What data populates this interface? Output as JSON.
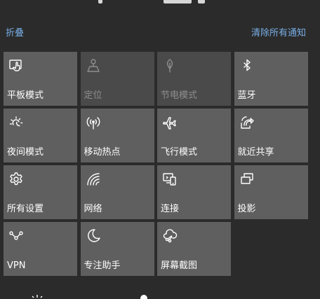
{
  "header": {
    "collapse_label": "折叠",
    "clear_all_label": "清除所有通知"
  },
  "tiles": [
    {
      "id": "tablet-mode",
      "label": "平板模式",
      "icon": "tablet-mode-icon",
      "enabled": true
    },
    {
      "id": "location",
      "label": "定位",
      "icon": "location-icon",
      "enabled": false
    },
    {
      "id": "battery-saver",
      "label": "节电模式",
      "icon": "battery-saver-icon",
      "enabled": false
    },
    {
      "id": "bluetooth",
      "label": "蓝牙",
      "icon": "bluetooth-icon",
      "enabled": true
    },
    {
      "id": "night-light",
      "label": "夜间模式",
      "icon": "night-light-icon",
      "enabled": true
    },
    {
      "id": "mobile-hotspot",
      "label": "移动热点",
      "icon": "hotspot-icon",
      "enabled": true
    },
    {
      "id": "airplane-mode",
      "label": "飞行模式",
      "icon": "airplane-icon",
      "enabled": true
    },
    {
      "id": "nearby-sharing",
      "label": "就近共享",
      "icon": "nearby-share-icon",
      "enabled": true
    },
    {
      "id": "all-settings",
      "label": "所有设置",
      "icon": "gear-icon",
      "enabled": true
    },
    {
      "id": "network",
      "label": "网络",
      "icon": "network-icon",
      "enabled": true
    },
    {
      "id": "connect",
      "label": "连接",
      "icon": "connect-icon",
      "enabled": true
    },
    {
      "id": "project",
      "label": "投影",
      "icon": "project-icon",
      "enabled": true
    },
    {
      "id": "vpn",
      "label": "VPN",
      "icon": "vpn-icon",
      "enabled": true
    },
    {
      "id": "focus-assist",
      "label": "专注助手",
      "icon": "moon-icon",
      "enabled": true
    },
    {
      "id": "screen-snip",
      "label": "屏幕截图",
      "icon": "snip-icon",
      "enabled": true
    }
  ],
  "colors": {
    "background": "#2b2b2b",
    "tile": "#5f5f5f",
    "tile_disabled": "#4a4a4a",
    "link": "#78aee6",
    "text": "#ffffff",
    "text_disabled": "#8e8e8e"
  }
}
